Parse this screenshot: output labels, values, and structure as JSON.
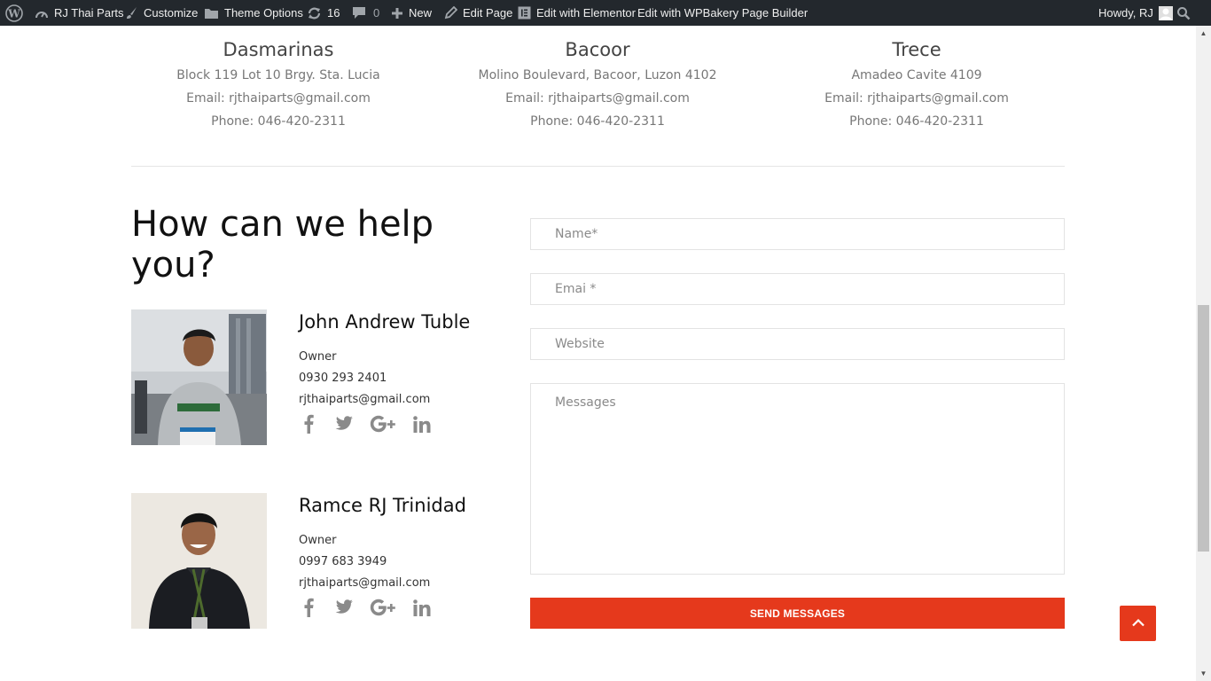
{
  "admin_bar": {
    "site_name": "RJ Thai Parts",
    "customize": "Customize",
    "theme_options": "Theme Options",
    "updates_count": "16",
    "comments_count": "0",
    "new": "New",
    "edit_page": "Edit Page",
    "edit_elementor": "Edit with Elementor",
    "edit_wpbakery": "Edit with WPBakery Page Builder",
    "howdy": "Howdy, RJ"
  },
  "locations": [
    {
      "name": "Dasmarinas",
      "address": "Block 119 Lot 10 Brgy. Sta. Lucia",
      "email": "Email: rjthaiparts@gmail.com",
      "phone": "Phone: 046-420-2311"
    },
    {
      "name": "Bacoor",
      "address": "Molino Boulevard, Bacoor, Luzon 4102",
      "email": "Email: rjthaiparts@gmail.com",
      "phone": "Phone: 046-420-2311"
    },
    {
      "name": "Trece",
      "address": "Amadeo Cavite 4109",
      "email": "Email: rjthaiparts@gmail.com",
      "phone": "Phone: 046-420-2311"
    }
  ],
  "help": {
    "title": "How can we help you?"
  },
  "people": [
    {
      "name": "John Andrew Tuble",
      "role": "Owner",
      "phone": "0930 293 2401",
      "email": "rjthaiparts@gmail.com"
    },
    {
      "name": "Ramce RJ Trinidad",
      "role": "Owner",
      "phone": "0997 683 3949",
      "email": "rjthaiparts@gmail.com"
    }
  ],
  "form": {
    "name_placeholder": "Name*",
    "email_placeholder": "Emai *",
    "website_placeholder": "Website",
    "message_placeholder": "Messages",
    "submit_label": "SEND MESSAGES"
  },
  "colors": {
    "accent": "#e5391c",
    "admin_bar": "#23282d",
    "text_muted": "#777777"
  },
  "icons": {
    "social": [
      "facebook-icon",
      "twitter-icon",
      "google-plus-icon",
      "linkedin-icon"
    ],
    "back_to_top": "chevron-up-icon"
  }
}
